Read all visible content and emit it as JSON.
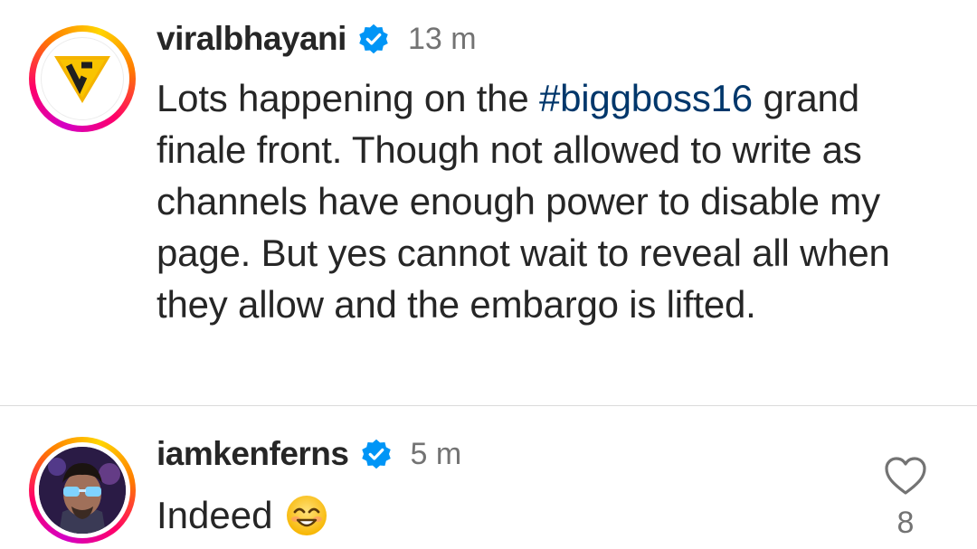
{
  "post": {
    "username": "viralbhayani",
    "time": "13 m",
    "caption_before": "Lots happening on the ",
    "hashtag": "#biggboss16",
    "caption_after": " grand finale front. Though not allowed to write as channels have enough power to disable my page. But yes cannot wait to reveal all when they allow and the embargo is lifted.",
    "avatar_icon": "viral-bhayani-logo-icon",
    "verified_icon": "verified-badge-icon"
  },
  "comment": {
    "username": "iamkenferns",
    "time": "5 m",
    "text": "Indeed",
    "emoji_icon": "smiling-face-emoji-icon",
    "like_icon": "heart-outline-icon",
    "like_count": "8"
  },
  "colors": {
    "text": "#262626",
    "secondary": "#737373",
    "hashtag": "#00376b",
    "verified": "#0095f6",
    "divider": "#dbdbdb"
  }
}
